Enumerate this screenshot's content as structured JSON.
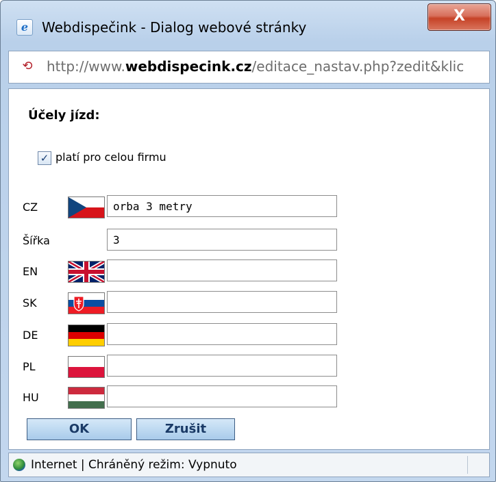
{
  "window": {
    "title": "Webdispečink - Dialog webové stránky",
    "close_label": "X",
    "app_icon_glyph": "e"
  },
  "address": {
    "url_prefix": "http://www.",
    "url_host": "webdispecink.cz",
    "url_path": "/editace_nastav.php?zedit&klic"
  },
  "form": {
    "section_title": "Účely jízd:",
    "checkbox": {
      "label": "platí pro celou firmu",
      "checked": true,
      "glyph": "✓"
    },
    "rows": [
      {
        "lang": "CZ",
        "flag": "flag-cz",
        "value": "orba 3 metry"
      },
      {
        "lang": "Šířka",
        "flag": null,
        "value": "3"
      },
      {
        "lang": "EN",
        "flag": "flag-uk",
        "value": ""
      },
      {
        "lang": "SK",
        "flag": "flag-sk",
        "value": ""
      },
      {
        "lang": "DE",
        "flag": "flag-de",
        "value": ""
      },
      {
        "lang": "PL",
        "flag": "flag-pl",
        "value": ""
      },
      {
        "lang": "HU",
        "flag": "flag-hu",
        "value": ""
      }
    ],
    "ok_label": "OK",
    "cancel_label": "Zrušit"
  },
  "status": {
    "text": "Internet | Chráněný režim: Vypnuto"
  },
  "colors": {
    "titlebar": "#c3d7ee",
    "close_button": "#c64227",
    "button_text": "#1a3a66"
  }
}
